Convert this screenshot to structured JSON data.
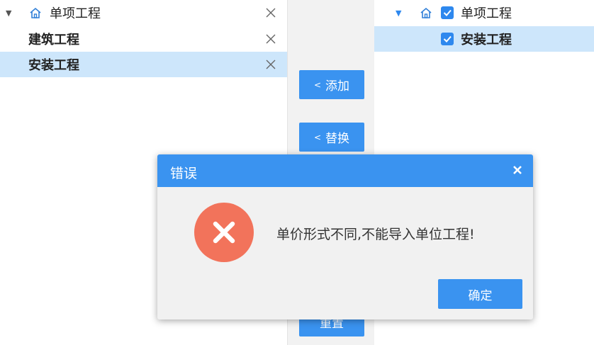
{
  "left_tree": {
    "root": {
      "label": "单项工程"
    },
    "items": [
      {
        "label": "建筑工程"
      },
      {
        "label": "安装工程"
      }
    ]
  },
  "middle": {
    "add_label": "添加",
    "replace_label": "替换",
    "reset_label": "重置",
    "arrow": "<"
  },
  "right_tree": {
    "root": {
      "label": "单项工程",
      "checked": true
    },
    "items": [
      {
        "label": "安装工程",
        "checked": true
      }
    ]
  },
  "dialog": {
    "title": "错误",
    "message": "单价形式不同,不能导入单位工程!",
    "ok_label": "确定"
  },
  "colors": {
    "accent": "#3a93f0",
    "selected_row": "#cde6fb",
    "error": "#f2735b"
  }
}
